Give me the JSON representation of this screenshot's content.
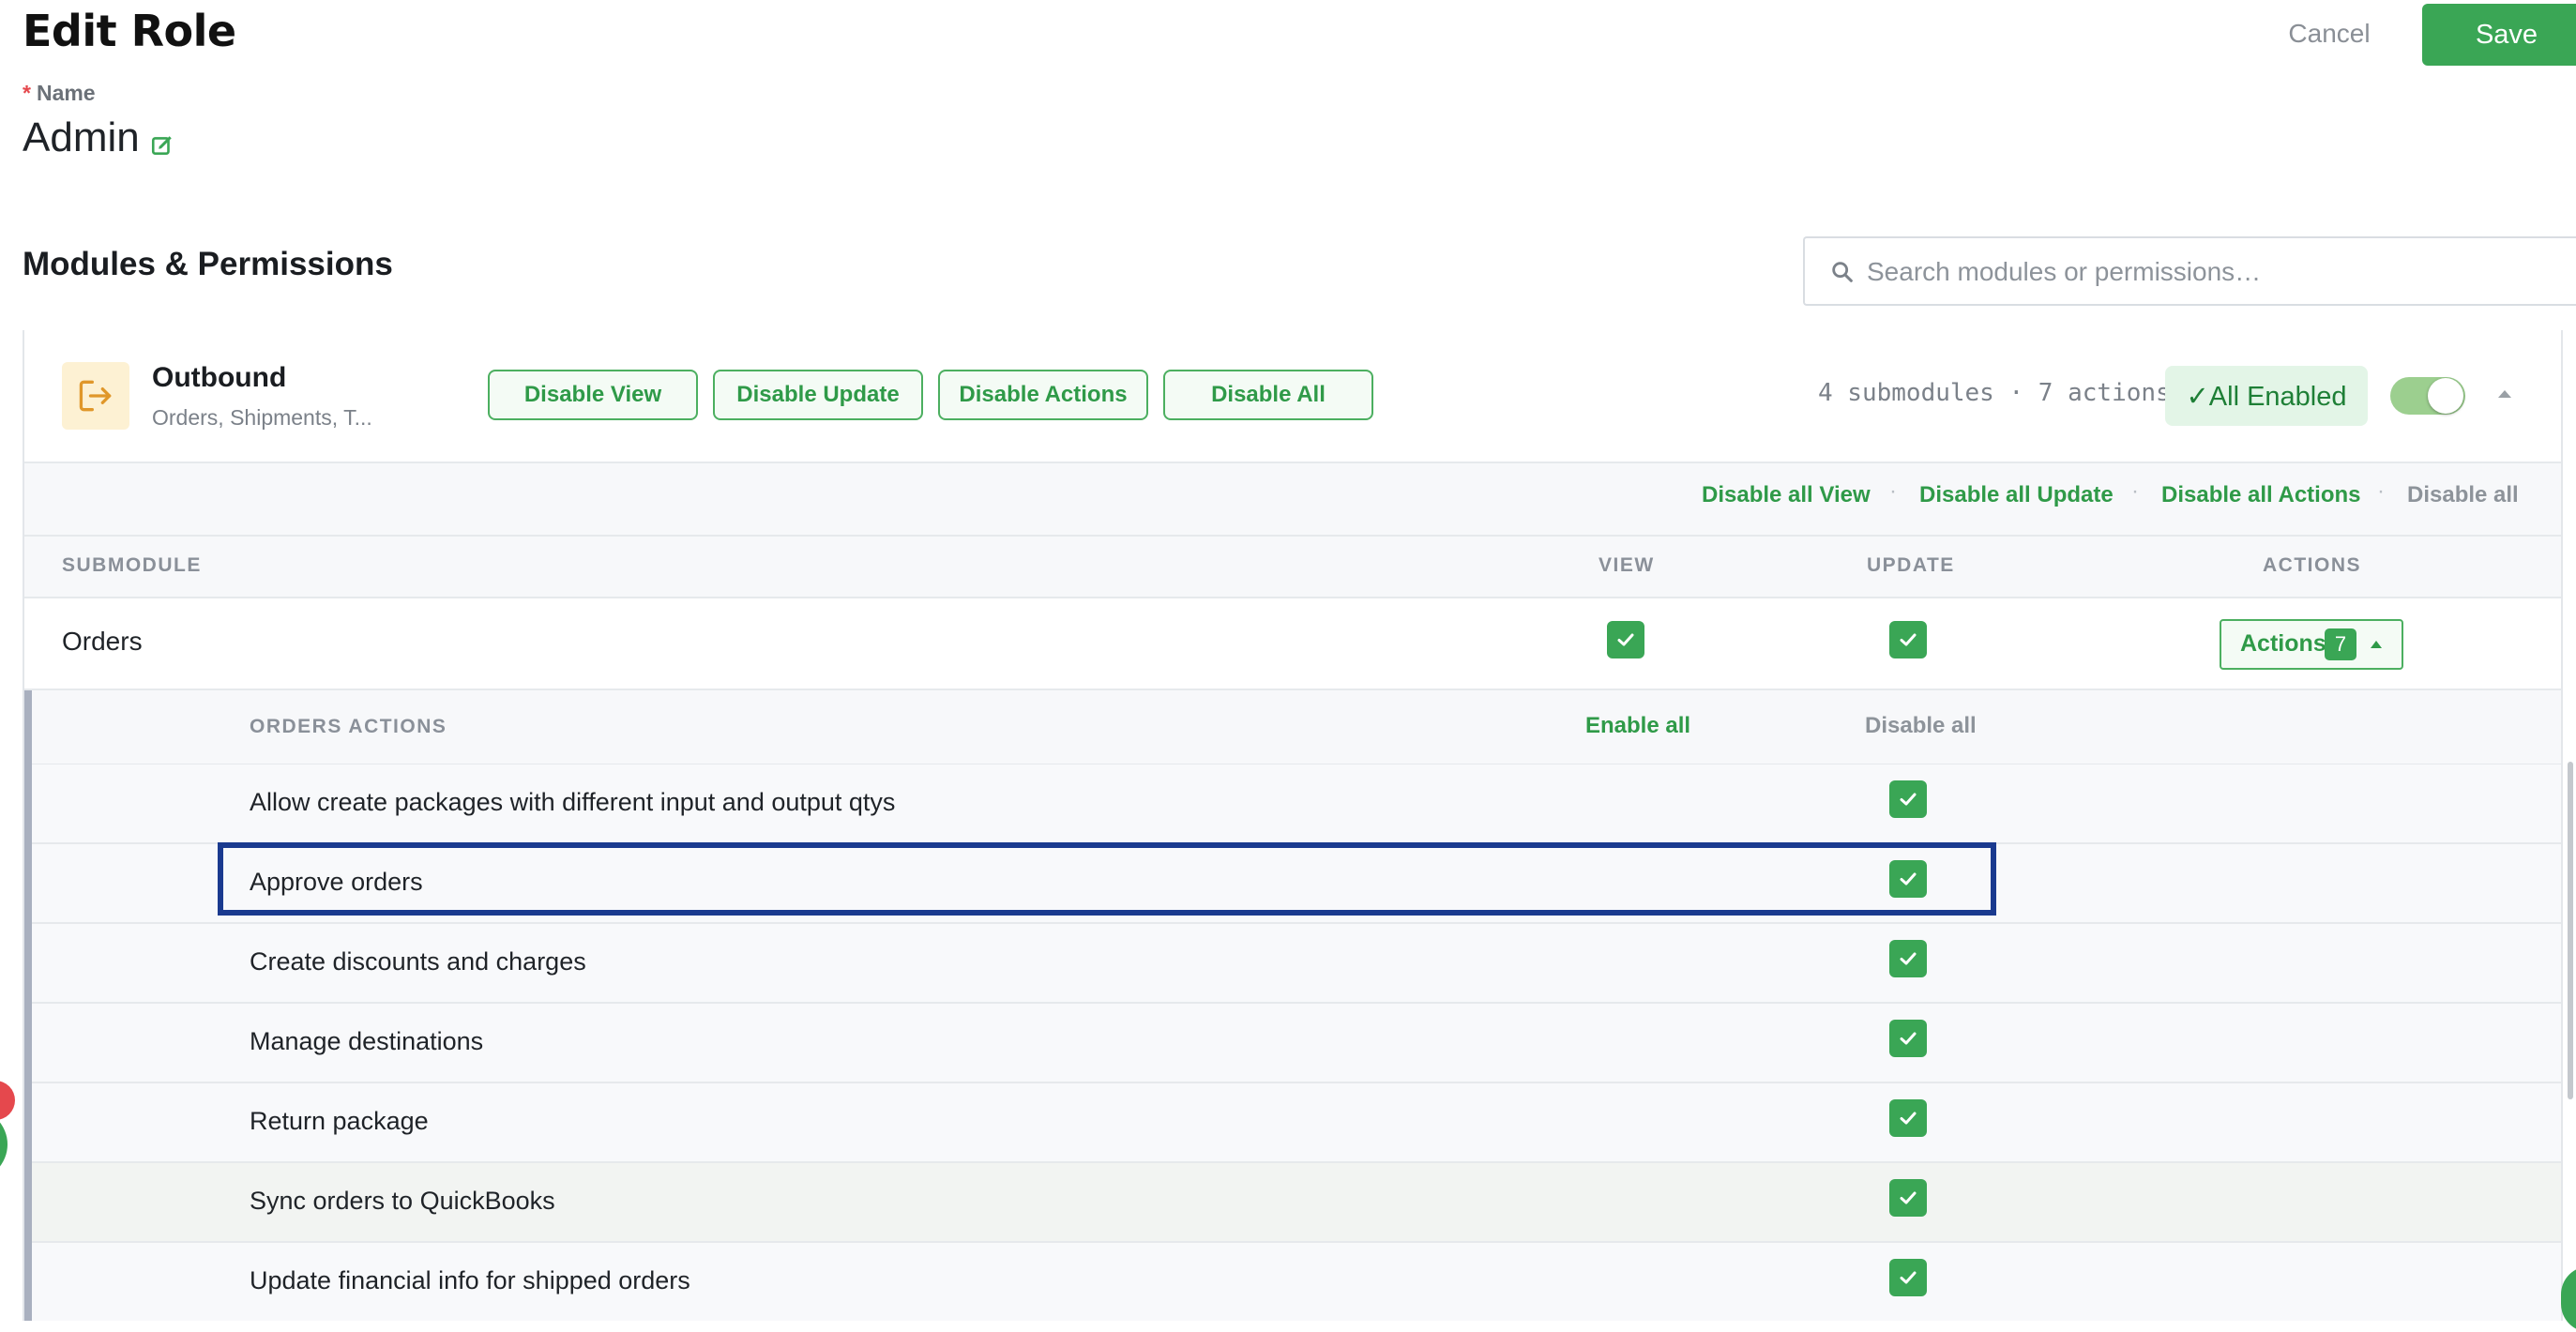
{
  "page": {
    "title": "Edit Role"
  },
  "header": {
    "cancel_label": "Cancel",
    "save_label": "Save"
  },
  "role": {
    "name_label": "Name",
    "required_mark": "*",
    "name_value": "Admin"
  },
  "section": {
    "title": "Modules & Permissions"
  },
  "search": {
    "placeholder": "Search modules or permissions…"
  },
  "module": {
    "name": "Outbound",
    "subtitle": "Orders, Shipments, T...",
    "buttons": [
      "Disable View",
      "Disable Update",
      "Disable Actions",
      "Disable All"
    ],
    "counts": "4 submodules · 7 actions",
    "status": "✓All Enabled",
    "enabled": true
  },
  "bulk": {
    "disable_view": "Disable all View",
    "disable_update": "Disable all Update",
    "disable_actions": "Disable all Actions",
    "disable_all": "Disable all",
    "separator": "·"
  },
  "table": {
    "headers": {
      "submodule": "SUBMODULE",
      "view": "VIEW",
      "update": "UPDATE",
      "actions": "ACTIONS"
    },
    "rows": [
      {
        "name": "Orders",
        "view": true,
        "update": true,
        "actions_label": "Actions",
        "actions_count": "7",
        "expanded": true
      }
    ]
  },
  "orders_actions": {
    "title": "ORDERS ACTIONS",
    "enable_all": "Enable all",
    "disable_all": "Disable all",
    "items": [
      {
        "label": "Allow create packages with different input and output qtys",
        "checked": true
      },
      {
        "label": "Approve orders",
        "checked": true,
        "highlighted": true
      },
      {
        "label": "Create discounts and charges",
        "checked": true
      },
      {
        "label": "Manage destinations",
        "checked": true
      },
      {
        "label": "Return package",
        "checked": true
      },
      {
        "label": "Sync orders to QuickBooks",
        "checked": true
      },
      {
        "label": "Update financial info for shipped orders",
        "checked": true
      }
    ]
  },
  "colors": {
    "accent": "#3aa655",
    "highlight_border": "#1a3a8f",
    "module_icon_bg": "#fdf1d3",
    "module_icon": "#e0972a"
  }
}
